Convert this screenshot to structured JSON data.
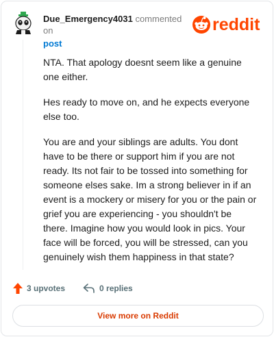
{
  "header": {
    "username": "Due_Emergency4031",
    "commented_on": "commented on",
    "post_link": "post",
    "logo_text": "reddit"
  },
  "comment": {
    "paragraphs": [
      "NTA. That apology doesnt seem like a genuine one either.",
      "Hes ready to move on, and he expects everyone else too.",
      "You are and your siblings are adults. You dont have to be there or support him if you are not ready. Its not fair to be tossed into something for someone elses sake. Im a strong believer in if an event is a mockery or misery for you or the pain or grief you are experiencing - you shouldn't be there. Imagine how you would look in pics. Your face will be forced, you will be stressed, can you genuinely wish them happiness in that state?"
    ]
  },
  "actions": {
    "upvotes_label": "3 upvotes",
    "replies_label": "0 replies"
  },
  "footer": {
    "view_more_label": "View more on Reddit"
  },
  "colors": {
    "reddit_orange": "#ff4500",
    "link_blue": "#0079d3",
    "view_more_text": "#d93a00"
  },
  "icons": {
    "avatar": "snoo-avatar-icon",
    "logo": "reddit-snoo-icon",
    "upvote": "upvote-arrow-icon",
    "reply": "reply-arrow-icon"
  }
}
